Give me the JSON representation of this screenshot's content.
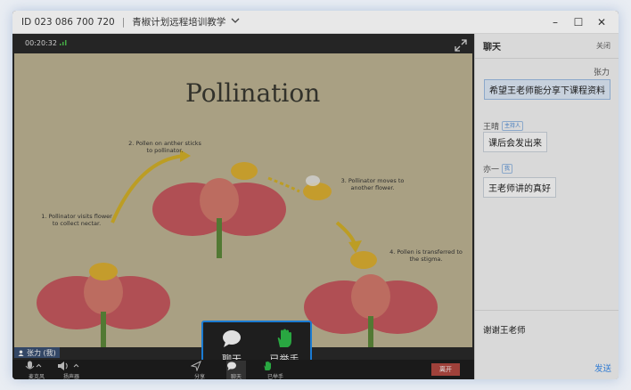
{
  "titlebar": {
    "meeting_id": "ID 023 086 700 720",
    "meeting_name": "青椒计划远程培训教学"
  },
  "video": {
    "timer": "00:20:32",
    "slide_title": "Pollination",
    "steps": [
      "1. Pollinator visits flower to collect nectar.",
      "2. Pollen on anther sticks to pollinator.",
      "3. Pollinator moves to another flower.",
      "4. Pollen is transferred to the stigma."
    ],
    "user_tag": "张力 (我)"
  },
  "toolbar": {
    "mic_label": "麦克风",
    "speaker_label": "扬声器",
    "share_label": "分享",
    "chat_label": "聊天",
    "hand_label": "已举手",
    "leave_label": "离开"
  },
  "popup": {
    "chat_label": "聊天",
    "hand_label": "已举手"
  },
  "chat": {
    "title": "聊天",
    "close_label": "关闭",
    "self_name": "张力",
    "self_message": "希望王老师能分享下课程资料",
    "messages": [
      {
        "sender": "王晴",
        "badge": "主持人",
        "text": "课后会发出来"
      },
      {
        "sender": "亦一",
        "badge": "我",
        "text": "王老师讲的真好"
      }
    ],
    "input_value": "谢谢王老师",
    "send_label": "发送"
  }
}
